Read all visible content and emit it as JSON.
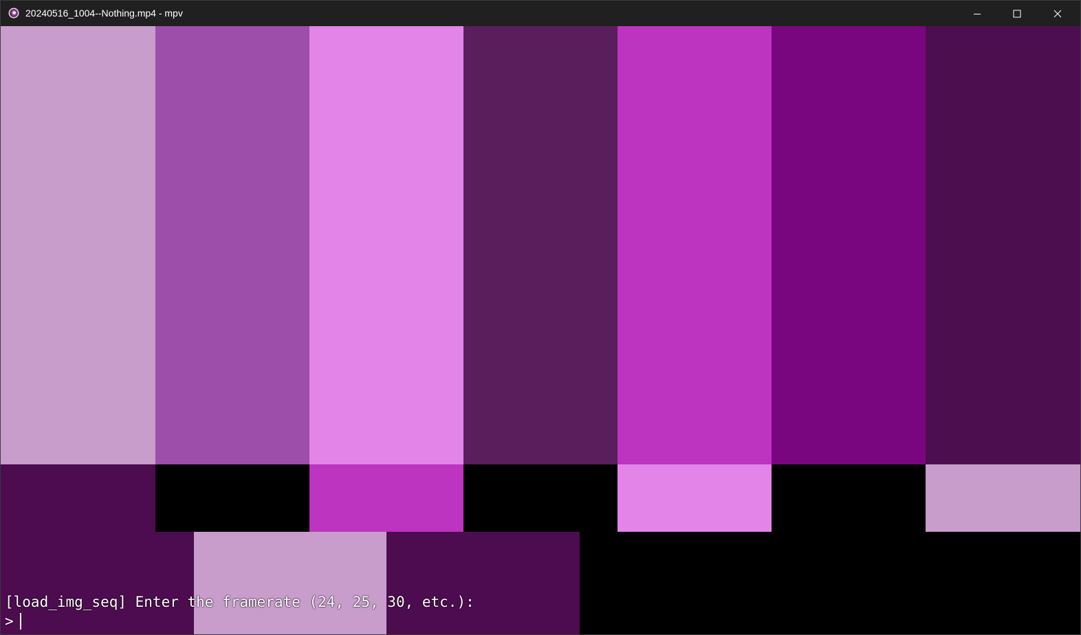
{
  "window": {
    "title": "20240516_1004--Nothing.mp4 - mpv",
    "app_icon": "mpv-logo-icon",
    "controls": {
      "minimize_icon": "minimize-icon",
      "maximize_icon": "maximize-icon",
      "close_icon": "close-icon"
    }
  },
  "colors": {
    "titlebar_bg": "#202020",
    "bar_1": "#c89ccb",
    "bar_2": "#9c4eaa",
    "bar_3": "#e384e9",
    "bar_4": "#5a1e5c",
    "bar_5": "#bc34bf",
    "bar_6": "#7a067f",
    "bar_7": "#4d0e50",
    "dark_purple": "#4c0c4f",
    "black": "#000000"
  },
  "console": {
    "message": "[load_img_seq] Enter the framerate (24, 25, 30, etc.):",
    "prompt_symbol": ">",
    "input_value": ""
  }
}
